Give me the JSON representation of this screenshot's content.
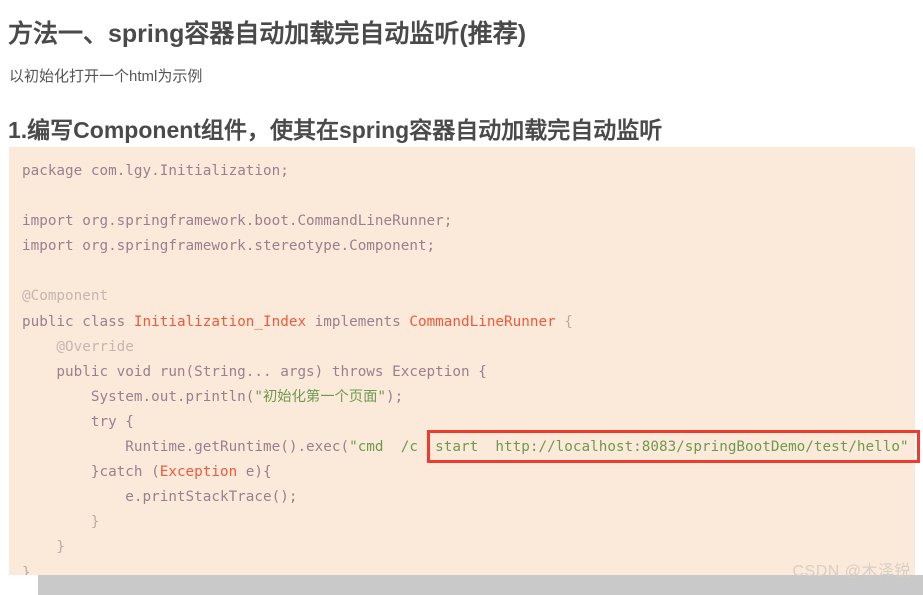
{
  "page": {
    "background": "#ffffff",
    "code_background": "#fbeada",
    "highlight_border_color": "#ef3b2d",
    "heading_color": "#4a4a4a"
  },
  "headings": {
    "main": "方法一、spring容器自动加载完自动监听(推荐)",
    "intro": "以初始化打开一个html为示例",
    "section": "1.编写Component组件，使其在spring容器自动加载完自动监听"
  },
  "code": {
    "language": "java",
    "lines": [
      {
        "id": 1,
        "tokens": [
          {
            "t": "package ",
            "c": "plain"
          },
          {
            "t": "com.lgy.Initialization;",
            "c": "plain"
          }
        ]
      },
      {
        "id": 2,
        "tokens": []
      },
      {
        "id": 3,
        "tokens": [
          {
            "t": "import org.springframework.boot.CommandLineRunner;",
            "c": "plain"
          }
        ]
      },
      {
        "id": 4,
        "tokens": [
          {
            "t": "import org.springframework.stereotype.Component;",
            "c": "plain"
          }
        ]
      },
      {
        "id": 5,
        "tokens": []
      },
      {
        "id": 6,
        "tokens": [
          {
            "t": "@Component",
            "c": "anno"
          }
        ]
      },
      {
        "id": 7,
        "tokens": [
          {
            "t": "public class ",
            "c": "kw"
          },
          {
            "t": "Initialization_Index",
            "c": "type"
          },
          {
            "t": " implements ",
            "c": "kw"
          },
          {
            "t": "CommandLineRunner",
            "c": "type"
          },
          {
            "t": " {",
            "c": "punc"
          }
        ]
      },
      {
        "id": 8,
        "tokens": [
          {
            "t": "    @Override",
            "c": "anno"
          }
        ]
      },
      {
        "id": 9,
        "tokens": [
          {
            "t": "    public void run(String... args) throws Exception {",
            "c": "kw"
          }
        ]
      },
      {
        "id": 10,
        "tokens": [
          {
            "t": "        System.out.println(",
            "c": "kw"
          },
          {
            "t": "\"初始化第一个页面\"",
            "c": "str"
          },
          {
            "t": ");",
            "c": "kw"
          }
        ]
      },
      {
        "id": 11,
        "tokens": [
          {
            "t": "        try {",
            "c": "kw"
          }
        ]
      },
      {
        "id": 12,
        "tokens": [
          {
            "t": "            Runtime.getRuntime().exec(",
            "c": "kw"
          },
          {
            "t": "\"cmd  /c  start  http://localhost:8083/springBootDemo/test/hello\"",
            "c": "str"
          }
        ]
      },
      {
        "id": 13,
        "tokens": [
          {
            "t": "        }catch (",
            "c": "kw"
          },
          {
            "t": "Exception",
            "c": "type"
          },
          {
            "t": " e){",
            "c": "kw"
          }
        ]
      },
      {
        "id": 14,
        "tokens": [
          {
            "t": "            e.printStackTrace();",
            "c": "kw"
          }
        ]
      },
      {
        "id": 15,
        "tokens": [
          {
            "t": "        }",
            "c": "punc"
          }
        ]
      },
      {
        "id": 16,
        "tokens": [
          {
            "t": "    }",
            "c": "punc"
          }
        ]
      },
      {
        "id": 17,
        "tokens": [
          {
            "t": "}",
            "c": "punc"
          }
        ]
      }
    ]
  },
  "highlight": {
    "label": "start-url-highlight",
    "text": "start  http://localhost:8083/springBootDemo/test/hello\""
  },
  "watermark": {
    "text": "CSDN @木泽锐"
  }
}
